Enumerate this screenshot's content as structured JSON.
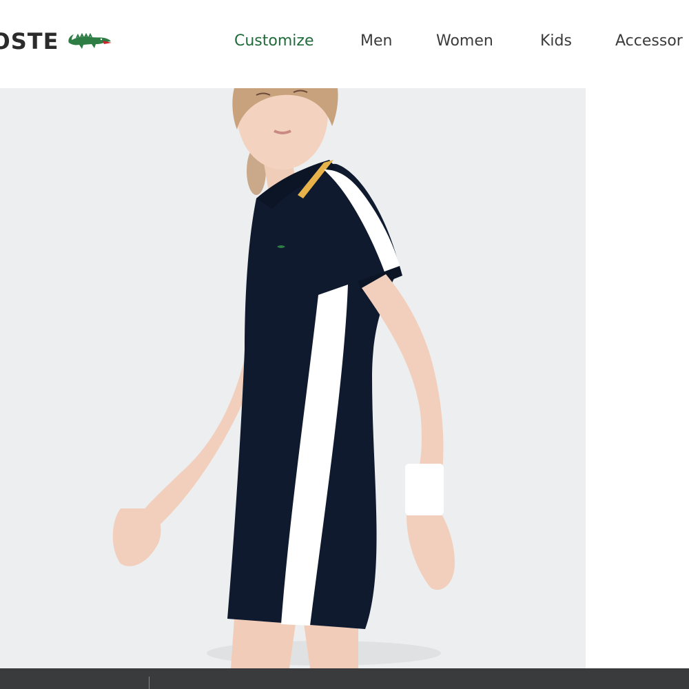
{
  "header": {
    "brand": "COSTE",
    "logo_icon": "crocodile-icon",
    "nav": [
      {
        "label": "Customize",
        "active": true
      },
      {
        "label": "Men",
        "active": false
      },
      {
        "label": "Women",
        "active": false
      },
      {
        "label": "Kids",
        "active": false
      },
      {
        "label": "Accessor",
        "active": false
      }
    ]
  },
  "hero": {
    "image": "woman-in-navy-polo-dress-photo"
  },
  "colors": {
    "accent_green": "#1f6b3a",
    "text": "#3b3b3b",
    "hero_bg": "#eceeef",
    "footer": "#3a3b3d",
    "navy": "#0f1a2e"
  }
}
